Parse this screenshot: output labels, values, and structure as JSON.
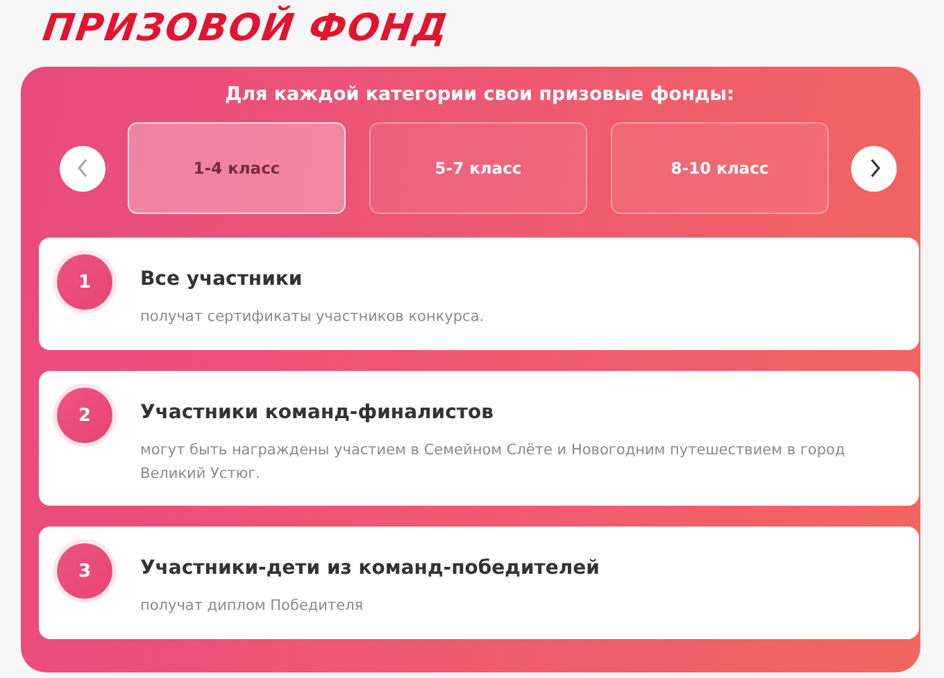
{
  "heading": "ПРИЗОВОЙ ФОНД",
  "panel": {
    "subtitle": "Для каждой категории свои призовые фонды:",
    "tabs": [
      {
        "label": "1-4 класс",
        "selected": true
      },
      {
        "label": "5-7 класс",
        "selected": false
      },
      {
        "label": "8-10 класс",
        "selected": false
      }
    ],
    "prizes": [
      {
        "number": "1",
        "title": "Все участники",
        "text": "получат сертификаты участников конкурса."
      },
      {
        "number": "2",
        "title": "Участники команд-финалистов",
        "text": "могут быть награждены участием в Семейном Слёте и Новогодним путешествием в город Великий Устюг."
      },
      {
        "number": "3",
        "title": "Участники-дети из команд-победителей",
        "text": "получат диплом Победителя"
      }
    ]
  }
}
